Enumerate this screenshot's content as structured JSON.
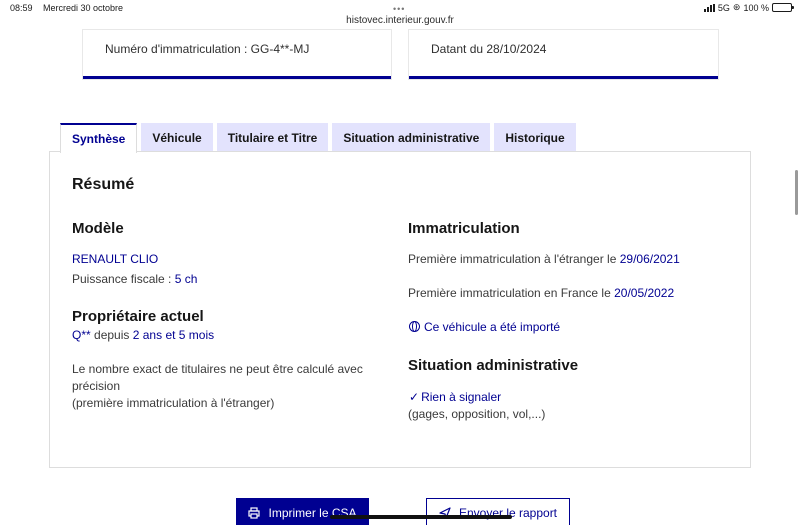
{
  "status_bar": {
    "time": "08:59",
    "date": "Mercredi 30 octobre",
    "network": "5G",
    "battery": "100 %"
  },
  "browser": {
    "url": "histovec.interieur.gouv.fr"
  },
  "cards": {
    "left_text": "Numéro d'immatriculation : GG-4**-MJ",
    "right_text": "Datant du 28/10/2024"
  },
  "tabs": [
    {
      "label": "Synthèse"
    },
    {
      "label": "Véhicule"
    },
    {
      "label": "Titulaire et Titre"
    },
    {
      "label": "Situation administrative"
    },
    {
      "label": "Historique"
    }
  ],
  "summary": {
    "title": "Résumé",
    "modele": {
      "heading": "Modèle",
      "name": "RENAULT CLIO",
      "puissance_label": "Puissance fiscale :",
      "puissance_value": "5 ch"
    },
    "proprietaire": {
      "heading": "Propriétaire actuel",
      "initial": "Q**",
      "depuis_label": "depuis",
      "duration": "2 ans et 5 mois",
      "note_line1": "Le nombre exact de titulaires ne peut être calculé avec",
      "note_line2": "précision",
      "note_line3": "(première immatriculation à l'étranger)"
    },
    "immatriculation": {
      "heading": "Immatriculation",
      "first_abroad_label": "Première immatriculation à l'étranger le",
      "first_abroad_date": "29/06/2021",
      "first_france_label": "Première immatriculation en France le",
      "first_france_date": "20/05/2022",
      "imported": "Ce véhicule a été importé"
    },
    "situation": {
      "heading": "Situation administrative",
      "status": "Rien à signaler",
      "detail": "(gages, opposition, vol,...)"
    }
  },
  "buttons": {
    "print": "Imprimer le CSA",
    "send": "Envoyer le rapport"
  },
  "colors": {
    "primary": "#000091",
    "tab_bg": "#e3e3fd"
  }
}
